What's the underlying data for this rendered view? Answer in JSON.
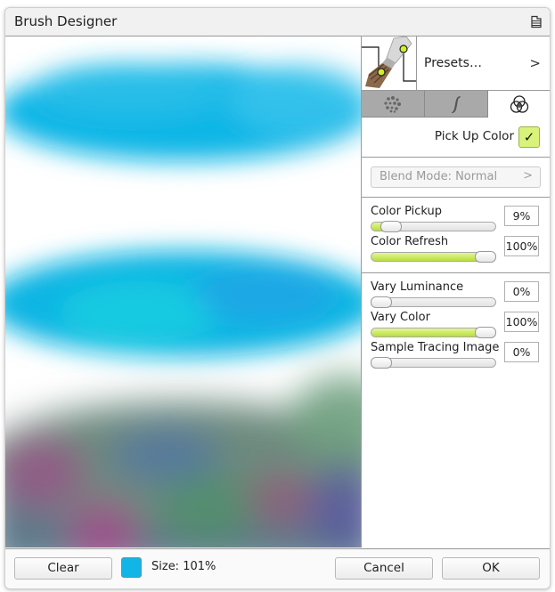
{
  "window": {
    "title": "Brush Designer",
    "menu_icon": "menu-list-icon"
  },
  "presets": {
    "label": "Presets…",
    "chevron": ">",
    "thumbnail_icon": "brush-preview-icon"
  },
  "tabs": [
    {
      "name": "grain",
      "icon": "dots-icon",
      "active": false
    },
    {
      "name": "stroke",
      "icon": "curve-icon",
      "active": false
    },
    {
      "name": "color",
      "icon": "color-circles-icon",
      "active": true
    }
  ],
  "pickup": {
    "label": "Pick Up Color",
    "checked": true,
    "check_glyph": "✓"
  },
  "blend_mode": {
    "label": "Blend Mode: Normal",
    "chevron": ">",
    "enabled": false
  },
  "sliders_group1": [
    {
      "label": "Color Pickup",
      "value": 9,
      "display": "9%"
    },
    {
      "label": "Color Refresh",
      "value": 100,
      "display": "100%"
    }
  ],
  "sliders_group2": [
    {
      "label": "Vary Luminance",
      "value": 0,
      "display": "0%"
    },
    {
      "label": "Vary Color",
      "value": 100,
      "display": "100%"
    },
    {
      "label": "Sample Tracing Image",
      "value": 0,
      "display": "0%"
    }
  ],
  "bottom": {
    "clear_label": "Clear",
    "swatch_color": "#11b5e6",
    "size_label": "Size: 101%",
    "cancel_label": "Cancel",
    "ok_label": "OK"
  },
  "colors": {
    "accent_green": "#c6e84a",
    "canvas_cyan": "#0fb8e6"
  }
}
